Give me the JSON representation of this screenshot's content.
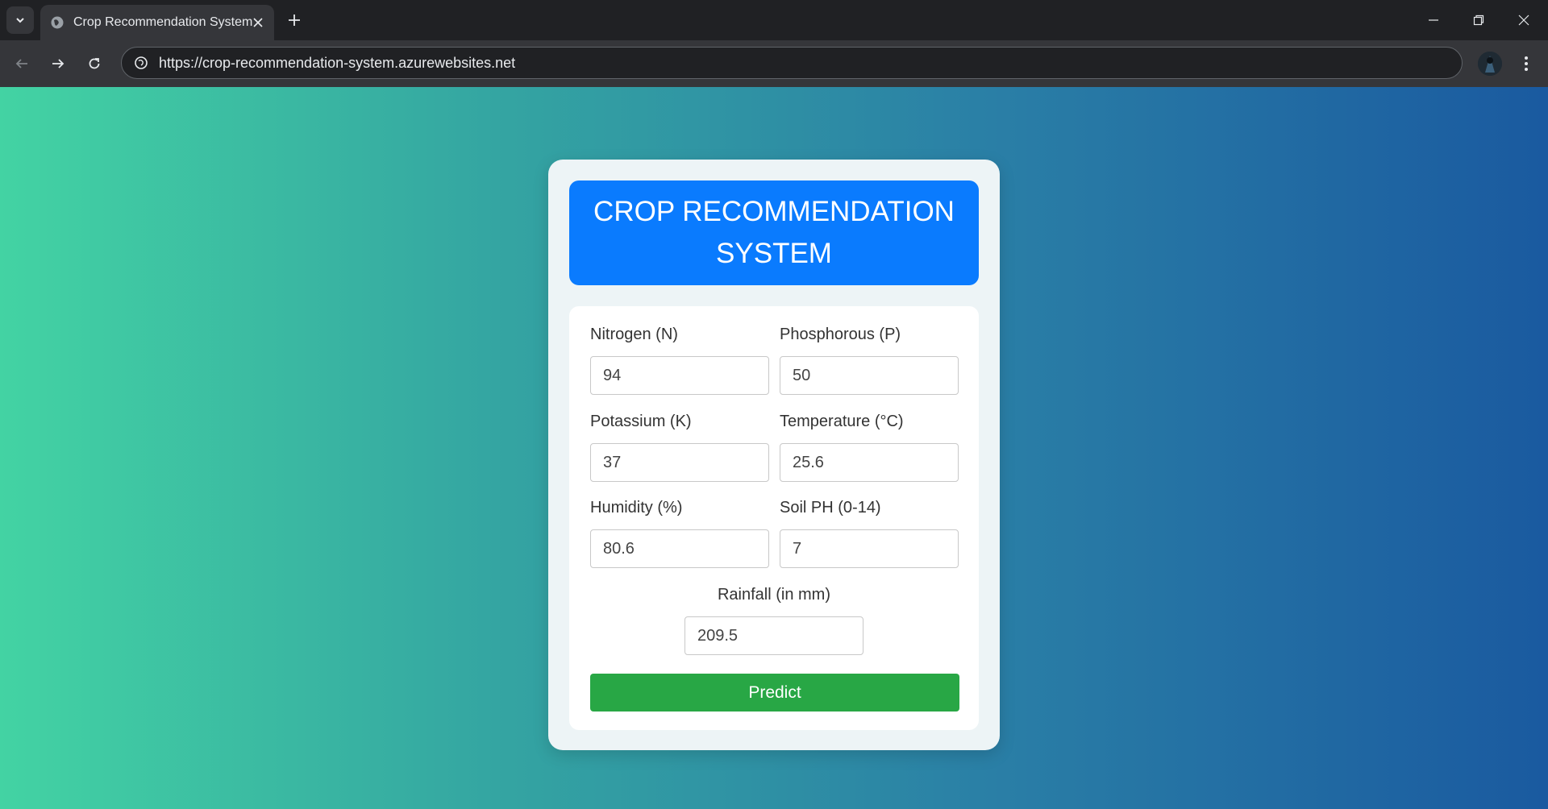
{
  "browser": {
    "tab_title": "Crop Recommendation System",
    "url": "https://crop-recommendation-system.azurewebsites.net"
  },
  "page": {
    "header_title": "CROP RECOMMENDATION SYSTEM",
    "fields": {
      "nitrogen": {
        "label": "Nitrogen (N)",
        "value": "94"
      },
      "phosphorous": {
        "label": "Phosphorous (P)",
        "value": "50"
      },
      "potassium": {
        "label": "Potassium (K)",
        "value": "37"
      },
      "temperature": {
        "label": "Temperature (°C)",
        "value": "25.6"
      },
      "humidity": {
        "label": "Humidity (%)",
        "value": "80.6"
      },
      "ph": {
        "label": "Soil PH (0-14)",
        "value": "7"
      },
      "rainfall": {
        "label": "Rainfall (in mm)",
        "value": "209.5"
      }
    },
    "predict_label": "Predict"
  },
  "colors": {
    "header_bg": "#0a7bfe",
    "predict_bg": "#28a745",
    "gradient_start": "#43d3a3",
    "gradient_end": "#1a5aa0"
  },
  "icons": {
    "tab_favicon": "globe-icon",
    "tab_close": "close-icon",
    "new_tab": "plus-icon",
    "back": "arrow-left-icon",
    "forward": "arrow-right-icon",
    "reload": "reload-icon",
    "site_info": "site-info-icon",
    "menu": "kebab-menu-icon"
  }
}
